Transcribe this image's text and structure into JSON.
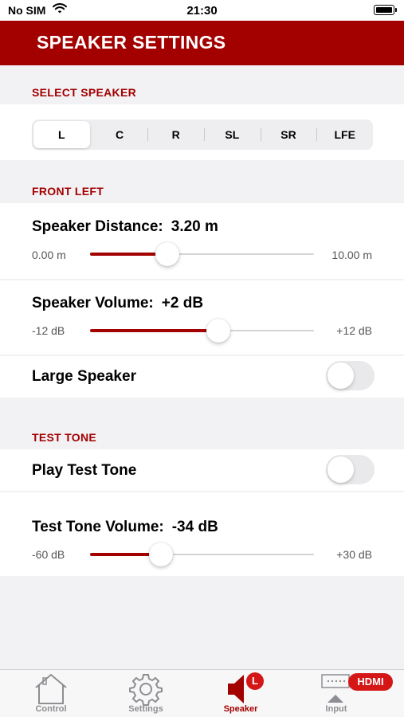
{
  "status_bar": {
    "carrier": "No SIM",
    "time": "21:30"
  },
  "header": {
    "title": "SPEAKER SETTINGS"
  },
  "select_speaker": {
    "section_title": "SELECT SPEAKER",
    "options": [
      "L",
      "C",
      "R",
      "SL",
      "SR",
      "LFE"
    ],
    "selected": "L"
  },
  "front_left": {
    "section_title": "FRONT LEFT",
    "distance": {
      "label": "Speaker Distance:",
      "value": "3.20 m",
      "min": "0.00 m",
      "max": "10.00 m",
      "fraction": 0.345
    },
    "volume": {
      "label": "Speaker Volume:",
      "value": "+2 dB",
      "min": "-12 dB",
      "max": "+12 dB",
      "fraction": 0.574
    },
    "large_speaker": {
      "label": "Large Speaker",
      "on": false
    }
  },
  "test_tone": {
    "section_title": "TEST TONE",
    "play": {
      "label": "Play Test Tone",
      "on": false
    },
    "volume": {
      "label": "Test Tone Volume:",
      "value": "-34 dB",
      "min": "-60 dB",
      "max": "+30 dB",
      "fraction": 0.318
    }
  },
  "tabs": [
    {
      "label": "Control",
      "icon": "house-icon"
    },
    {
      "label": "Settings",
      "icon": "gear-icon"
    },
    {
      "label": "Speaker",
      "icon": "speaker-icon",
      "badge": "L",
      "active": true
    },
    {
      "label": "Input",
      "icon": "input-icon",
      "badge": "HDMI"
    }
  ],
  "colors": {
    "accent": "#a30000",
    "background": "#f2f2f4",
    "badge": "#d41616"
  }
}
